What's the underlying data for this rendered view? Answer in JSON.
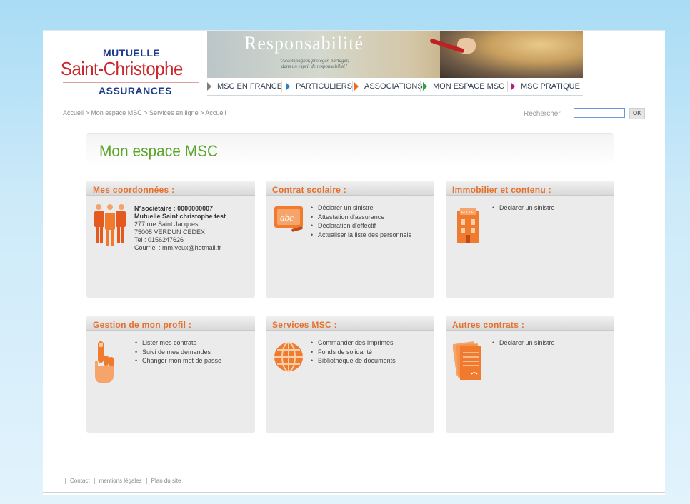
{
  "logo": {
    "line1": "MUTUELLE",
    "line2": "Saint-Christophe",
    "line3": "ASSURANCES"
  },
  "banner": {
    "title": "Responsabilité",
    "subtitle_l1": "\"Accompagner, protéger, partager,",
    "subtitle_l2": "dans un esprit de responsabilité\""
  },
  "nav": [
    "MSC EN FRANCE",
    "PARTICULIERS",
    "ASSOCIATIONS",
    "MON ESPACE MSC",
    "MSC PRATIQUE"
  ],
  "breadcrumb": "Accueil > Mon espace MSC > Services en ligne > Accueil",
  "search": {
    "label": "Rechercher",
    "value": "",
    "ok": "OK"
  },
  "page_title": "Mon espace MSC",
  "panels": {
    "coordonnees": {
      "title": "Mes coordonnées :",
      "societaire": "N°sociétaire : 0000000007",
      "name": "Mutuelle Saint christophe test",
      "address1": "277 rue Saint Jacques",
      "address2": "75005 VERDUN CEDEX",
      "tel": "Tel : 0156247626",
      "email": "Courriel : mm.veux@hotmail.fr"
    },
    "scolaire": {
      "title": "Contrat scolaire :",
      "items": [
        "Déclarer un sinistre",
        "Attestation d'assurance",
        "Déclaration d'effectif",
        "Actualiser la liste des personnels"
      ]
    },
    "immobilier": {
      "title": "Immobilier et contenu :",
      "items": [
        "Déclarer un sinistre"
      ]
    },
    "profil": {
      "title": "Gestion de mon profil :",
      "items": [
        "Lister mes contrats",
        "Suivi de mes demandes",
        "Changer mon mot de passe"
      ]
    },
    "services": {
      "title": "Services MSC :",
      "items": [
        "Commander des imprimés",
        "Fonds de solidarité",
        "Bibliothèque de documents"
      ]
    },
    "autres": {
      "title": "Autres contrats :",
      "items": [
        "Déclarer un sinistre"
      ]
    }
  },
  "footer": [
    "Contact",
    "mentions légales",
    "Plan du site"
  ],
  "colors": {
    "accent_orange": "#e6702b",
    "title_green": "#5aa62a",
    "brand_red": "#c9282d",
    "brand_blue": "#1d3b8c"
  }
}
